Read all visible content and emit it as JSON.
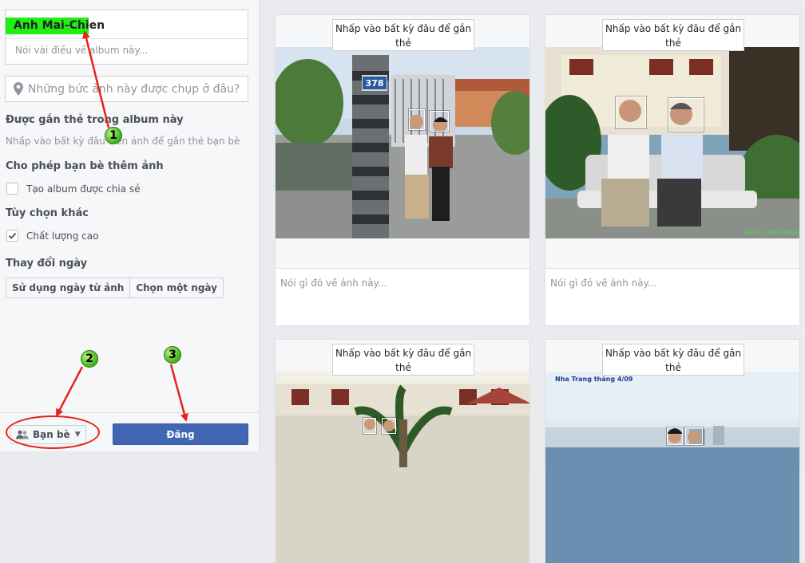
{
  "album": {
    "title": "Anh Mai-Chien",
    "description_placeholder": "Nói vài điều về album này..."
  },
  "location": {
    "placeholder": "Những bức ảnh này được chụp ở đâu?"
  },
  "tagging": {
    "heading": "Được gắn thẻ trong album này",
    "hint": "Nhấp vào bất kỳ đâu trên ảnh để gắn thẻ bạn bè"
  },
  "contributors": {
    "heading": "Cho phép bạn bè thêm ảnh",
    "checkbox_label": "Tạo album được chia sẻ",
    "checked": false
  },
  "options": {
    "heading": "Tùy chọn khác",
    "checkbox_label": "Chất lượng cao",
    "checked": true
  },
  "date": {
    "heading": "Thay đổi ngày",
    "use_photo_date": "Sử dụng ngày từ ảnh",
    "choose_date": "Chọn một ngày"
  },
  "footer": {
    "audience_label": "Bạn bè",
    "post_label": "Đăng"
  },
  "annotations": {
    "badge1": "1",
    "badge2": "2",
    "badge3": "3"
  },
  "photos": [
    {
      "tag_tip": "Nhấp vào bất kỳ đâu để gắn thẻ",
      "caption_placeholder": "Nói gì đó về ảnh này...",
      "sign_text": "378"
    },
    {
      "tag_tip": "Nhấp vào bất kỳ đâu để gắn thẻ",
      "caption_placeholder": "Nói gì đó về ảnh này...",
      "watermark": "ảnh lưu niệm ông bà"
    },
    {
      "tag_tip": "Nhấp vào bất kỳ đâu để gắn thẻ"
    },
    {
      "tag_tip": "Nhấp vào bất kỳ đâu để gắn thẻ",
      "photo_text": "Nha Trang tháng 4/09"
    }
  ],
  "colors": {
    "primary_button": "#4267b2",
    "highlight": "#22ee11",
    "annotation_red": "#e5231b",
    "badge_green": "#3fae1e"
  }
}
